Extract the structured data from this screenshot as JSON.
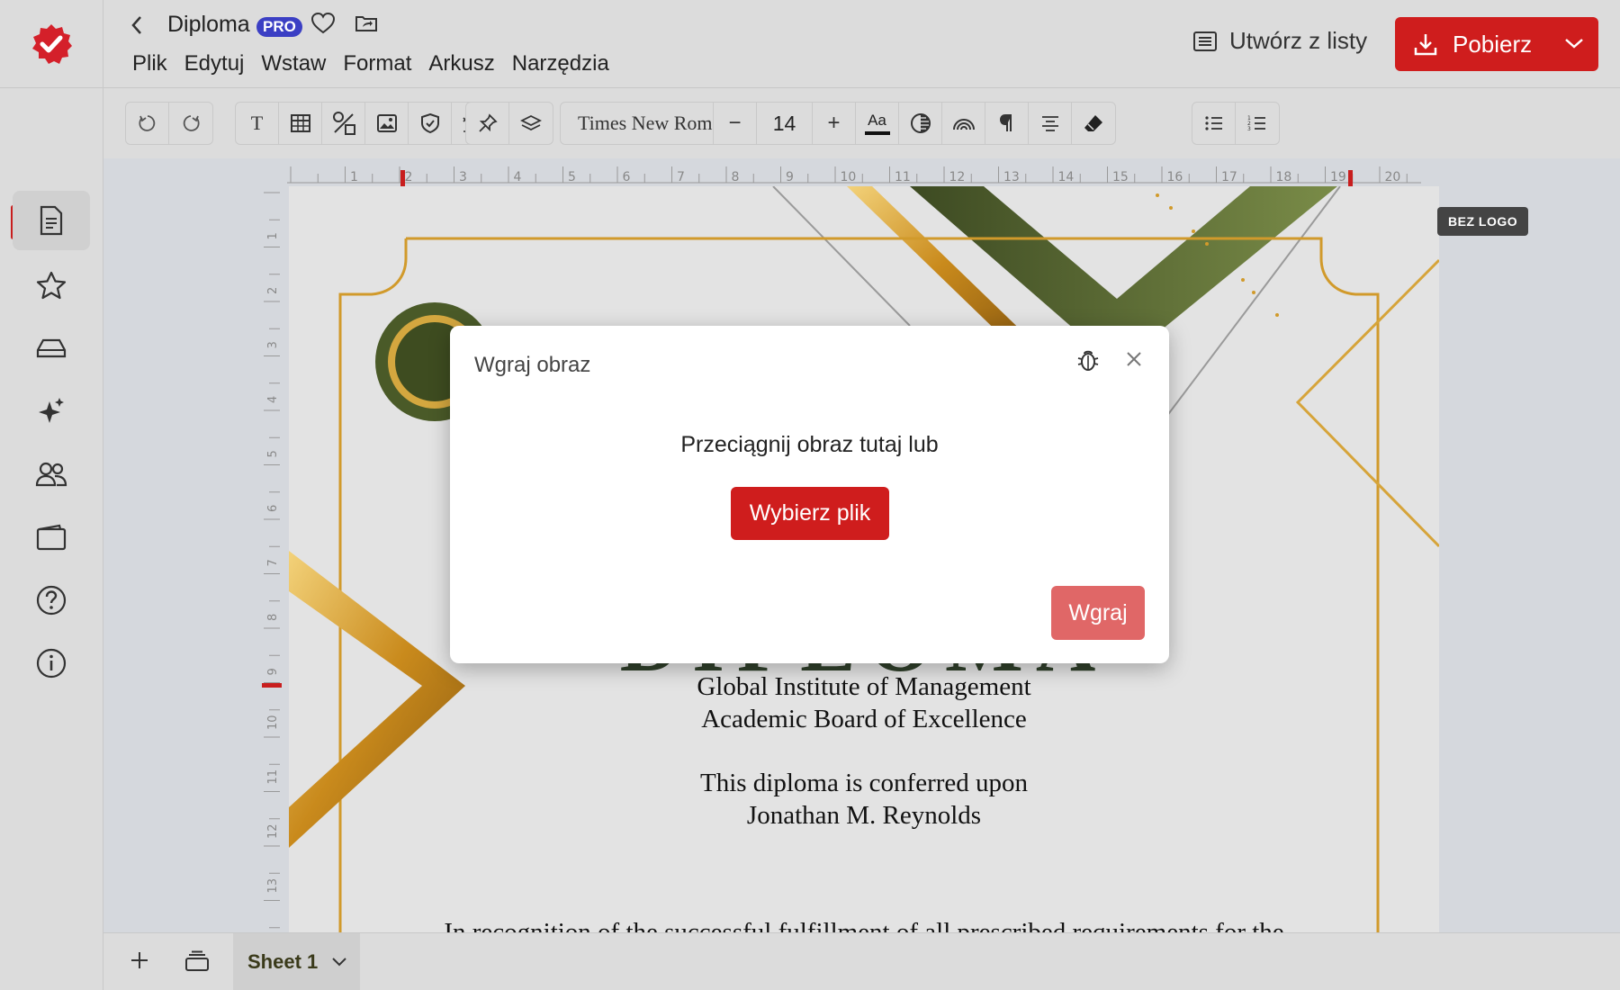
{
  "header": {
    "title": "Diploma",
    "pro_badge": "PRO",
    "menu": [
      "Plik",
      "Edytuj",
      "Wstaw",
      "Format",
      "Arkusz",
      "Narzędzia"
    ],
    "create_from_list": "Utwórz z listy",
    "download": "Pobierz"
  },
  "toolbar": {
    "font_name": "Times New Roman",
    "font_size": "14",
    "text_tool": "T",
    "case_label": "Aa",
    "minus": "−",
    "plus": "+"
  },
  "ruler": {
    "horizontal": [
      "1",
      "2",
      "3",
      "4",
      "5",
      "6",
      "7",
      "8",
      "9",
      "10",
      "11",
      "12",
      "13",
      "14",
      "15",
      "16",
      "17",
      "18",
      "19",
      "20"
    ],
    "vertical": [
      "1",
      "2",
      "3",
      "4",
      "5",
      "6",
      "7",
      "8",
      "9",
      "10",
      "11",
      "12",
      "13"
    ]
  },
  "page": {
    "badge": "BEZ LOGO",
    "institute": "Global Institute of Management",
    "board": "Academic Board of Excellence",
    "conferred": "This diploma is conferred upon",
    "recipient": "Jonathan M. Reynolds",
    "recognition": "In recognition of the successful fulfillment of all prescribed requirements for the"
  },
  "sheets": {
    "active": "Sheet 1"
  },
  "modal": {
    "title": "Wgraj obraz",
    "drop_text": "Przeciągnij obraz tutaj lub",
    "choose_file": "Wybierz plik",
    "upload": "Wgraj"
  },
  "colors": {
    "brand_red": "#cf1d1d",
    "upload_disabled": "#e06767",
    "pro_badge": "#3b3fc4",
    "gold": "#d19a2b",
    "olive": "#5b6b35"
  }
}
